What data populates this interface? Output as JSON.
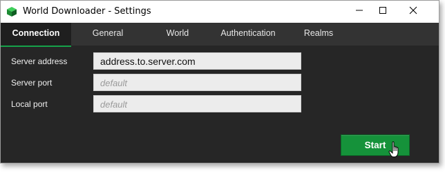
{
  "window": {
    "title": "World Downloader - Settings",
    "app_icon": "green-cube-icon",
    "controls": [
      "minimize-icon",
      "maximize-icon",
      "close-icon"
    ]
  },
  "tabs": [
    {
      "label": "Connection",
      "active": true
    },
    {
      "label": "General",
      "active": false
    },
    {
      "label": "World",
      "active": false
    },
    {
      "label": "Authentication",
      "active": false
    },
    {
      "label": "Realms",
      "active": false
    }
  ],
  "form": {
    "server_address": {
      "label": "Server address",
      "value": "address.to.server.com",
      "placeholder": ""
    },
    "server_port": {
      "label": "Server port",
      "value": "",
      "placeholder": "default"
    },
    "local_port": {
      "label": "Local port",
      "value": "",
      "placeholder": "default"
    }
  },
  "actions": {
    "start_label": "Start"
  },
  "colors": {
    "background": "#262626",
    "accent": "#15923a",
    "tab_bar": "#333333"
  },
  "cursor": "hand-pointer-icon"
}
